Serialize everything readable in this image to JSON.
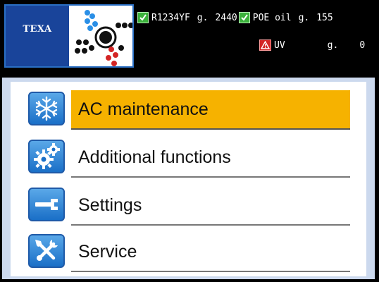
{
  "brand": {
    "logo_text": "TEXA",
    "logo_icon": "texa-logo",
    "mark_icon": "dot-matrix-mark"
  },
  "status": {
    "refrigerant": {
      "icon": "check-icon",
      "name": "R1234YF",
      "unit": "g.",
      "value": "2440"
    },
    "oil": {
      "icon": "check-icon",
      "name": "POE oil",
      "unit": "g.",
      "value": "155"
    },
    "uv": {
      "icon": "warning-icon",
      "name": "UV",
      "unit": "g.",
      "value": "0"
    }
  },
  "menu": {
    "selected_index": 0,
    "items": [
      {
        "label": "AC maintenance",
        "icon": "snowflake-icon"
      },
      {
        "label": "Additional functions",
        "icon": "gears-icon"
      },
      {
        "label": "Settings",
        "icon": "wrench-icon"
      },
      {
        "label": "Service",
        "icon": "tools-icon"
      }
    ]
  },
  "colors": {
    "selected_bg": "#f6b200",
    "icon_blue": "#1a6fc7",
    "panel_border": "#ccd9ee",
    "ok_green": "#3bb13b",
    "warn_red": "#d42525"
  }
}
